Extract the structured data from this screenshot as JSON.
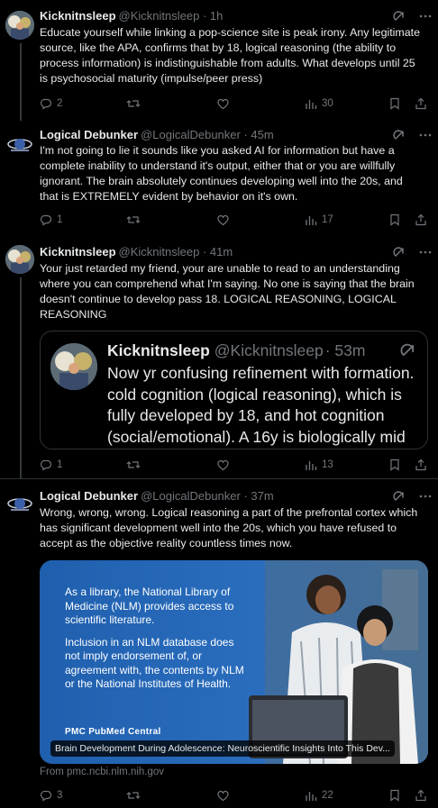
{
  "tweets": [
    {
      "name": "Kicknitnsleep",
      "handle": "@Kicknitnsleep",
      "time": "· 1h",
      "text": "Educate yourself while linking a pop-science site is peak irony. Any legitimate source, like the APA, confirms that by 18, logical reasoning (the ability to process information) is indistinguishable from adults. What develops until 25 is psychosocial maturity (impulse/peer press)",
      "replies": "2",
      "reposts": "",
      "likes": "",
      "views": "30"
    },
    {
      "name": "Logical Debunker",
      "handle": "@LogicalDebunker",
      "time": "· 45m",
      "text": "I'm not going to lie it sounds like you asked AI for information but have a complete inability to understand it's output, either that or you are willfully ignorant. The brain absolutely continues developing well into the 20s, and that is EXTREMELY evident by behavior on it's own.",
      "replies": "1",
      "reposts": "",
      "likes": "",
      "views": "17"
    },
    {
      "name": "Kicknitnsleep",
      "handle": "@Kicknitnsleep",
      "time": "· 41m",
      "text": "Your just retarded my friend, your are unable to read to an understanding where you can comprehend what I'm saying. No one is saying that the brain doesn't continue to develop pass 18. LOGICAL REASONING, LOGICAL REASONING",
      "replies": "1",
      "reposts": "",
      "likes": "",
      "views": "13",
      "quote": {
        "name": "Kicknitnsleep",
        "handle": "@Kicknitnsleep",
        "time": "· 53m",
        "text": "Now yr confusing refinement with formation. cold cognition (logical reasoning), which is fully developed by 18, and hot cognition (social/emotional). A 16y is biologically mid"
      }
    },
    {
      "name": "Logical Debunker",
      "handle": "@LogicalDebunker",
      "time": "· 37m",
      "text": "Wrong, wrong, wrong. Logical reasoning a part of the prefrontal cortex which has significant development well into the 20s, which you have refused to accept as the objective reality countless times now.",
      "replies": "3",
      "reposts": "",
      "likes": "",
      "views": "22",
      "card": {
        "para1": "As a library, the National Library of Medicine (NLM) provides access to scientific literature.",
        "para2": "Inclusion in an NLM database does not imply endorsement of, or agreement with, the contents by NLM or the National Institutes of Health.",
        "logo": "PMC PubMed Central",
        "title": "Brain Development During Adolescence: Neuroscientific Insights Into This Dev...",
        "from": "From pmc.ncbi.nlm.nih.gov"
      }
    }
  ],
  "icons": {
    "grok": "grok-icon",
    "more": "more-icon",
    "reply": "reply-icon",
    "repost": "repost-icon",
    "like": "like-icon",
    "views": "views-icon",
    "bookmark": "bookmark-icon",
    "share": "share-icon"
  },
  "colors": {
    "background": "#000000",
    "text": "#e7e9ea",
    "muted": "#71767b",
    "border": "#2f3336",
    "card": "#1f5fae"
  }
}
